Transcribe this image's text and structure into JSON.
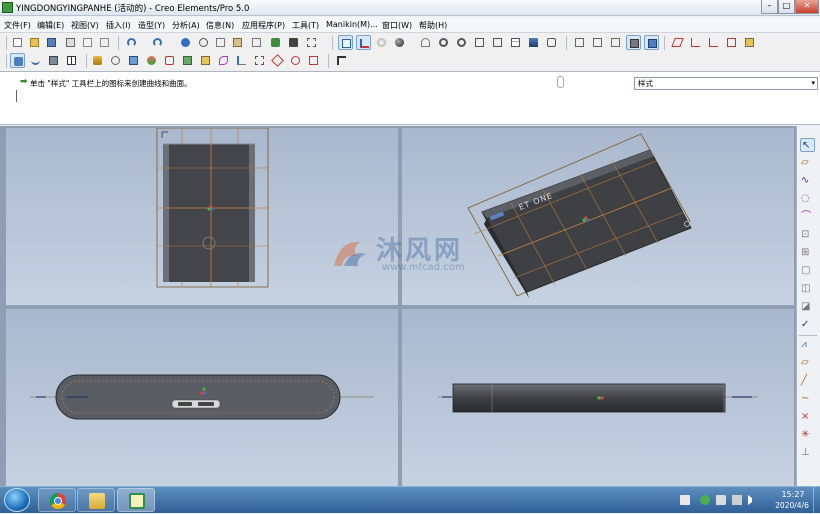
{
  "window": {
    "title": "YINGDONGYINGPANHE (活动的) - Creo Elements/Pro 5.0",
    "min_label": "–",
    "max_label": "□",
    "close_label": "✕"
  },
  "menu": [
    "文件(F)",
    "编辑(E)",
    "视图(V)",
    "插入(I)",
    "造型(Y)",
    "分析(A)",
    "信息(N)",
    "应用程序(P)",
    "工具(T)",
    "Manikin(M)...",
    "窗口(W)",
    "帮助(H)"
  ],
  "message": {
    "text": "单击 \"样式\" 工具栏上的图标来创建曲线和曲面。",
    "filter_value": "样式"
  },
  "model": {
    "label_text": "ET ONE"
  },
  "watermark": {
    "main": "沐风网",
    "sub": "www.mfcad.com"
  },
  "taskbar": {
    "time": "15:27",
    "date": "2020/4/6",
    "apps": [
      "chrome-icon",
      "folder-icon",
      "creo-icon"
    ]
  },
  "toolbar_icons": {
    "row1": [
      "new-icon",
      "open-icon",
      "save-icon",
      "print-icon",
      "email-icon",
      "copy-icon",
      "undo-icon",
      "redo-icon",
      "regenerate-icon",
      "cut-icon",
      "copy-clip-icon",
      "paste-icon",
      "paste-special-icon",
      "flashlight-icon",
      "find-icon",
      "select-box-icon",
      "refit-icon",
      "datum-icon",
      "appearance-icon",
      "sphere-icon",
      "spin-icon",
      "zoom-in-icon",
      "zoom-out-icon",
      "zoom-fit-icon",
      "view-manager-icon",
      "layers-icon",
      "repaint-icon",
      "saved-views-icon",
      "shaded-icon",
      "hidden-icon",
      "wireframe-icon",
      "enhanced-icon",
      "datum-plane-icon",
      "datum-axis-icon",
      "datum-point-icon",
      "csys-icon",
      "annotation-icon"
    ],
    "row2": [
      "style-icon",
      "curve-icon",
      "surface-icon",
      "table-icon",
      "blend-icon",
      "sweep-icon",
      "extrude-icon",
      "revolve-icon",
      "shell-icon",
      "draft-icon",
      "round-icon",
      "chamfer-icon",
      "rib-icon",
      "hole-icon",
      "pattern-icon",
      "mirror-icon",
      "merge-icon",
      "trim-icon",
      "whats-this-icon"
    ]
  },
  "right_toolbar": [
    "select-icon",
    "plane-icon",
    "curve-icon",
    "circle-icon",
    "arc-icon",
    "offset-icon",
    "edit-curve-icon",
    "surface-edit-icon",
    "surface-connect-icon",
    "trim-icon",
    "done-icon",
    "curve-analysis-icon",
    "plane-active-icon",
    "line-icon",
    "free-curve-icon",
    "point-icon",
    "intersect-icon",
    "combine-icon"
  ],
  "colors": {
    "accent": "#1b6fb8",
    "datum_orange": "#d9822b",
    "model_dark": "#3e4044",
    "viewport_top": "#a9b8cd",
    "viewport_bottom": "#c6d2e1"
  }
}
